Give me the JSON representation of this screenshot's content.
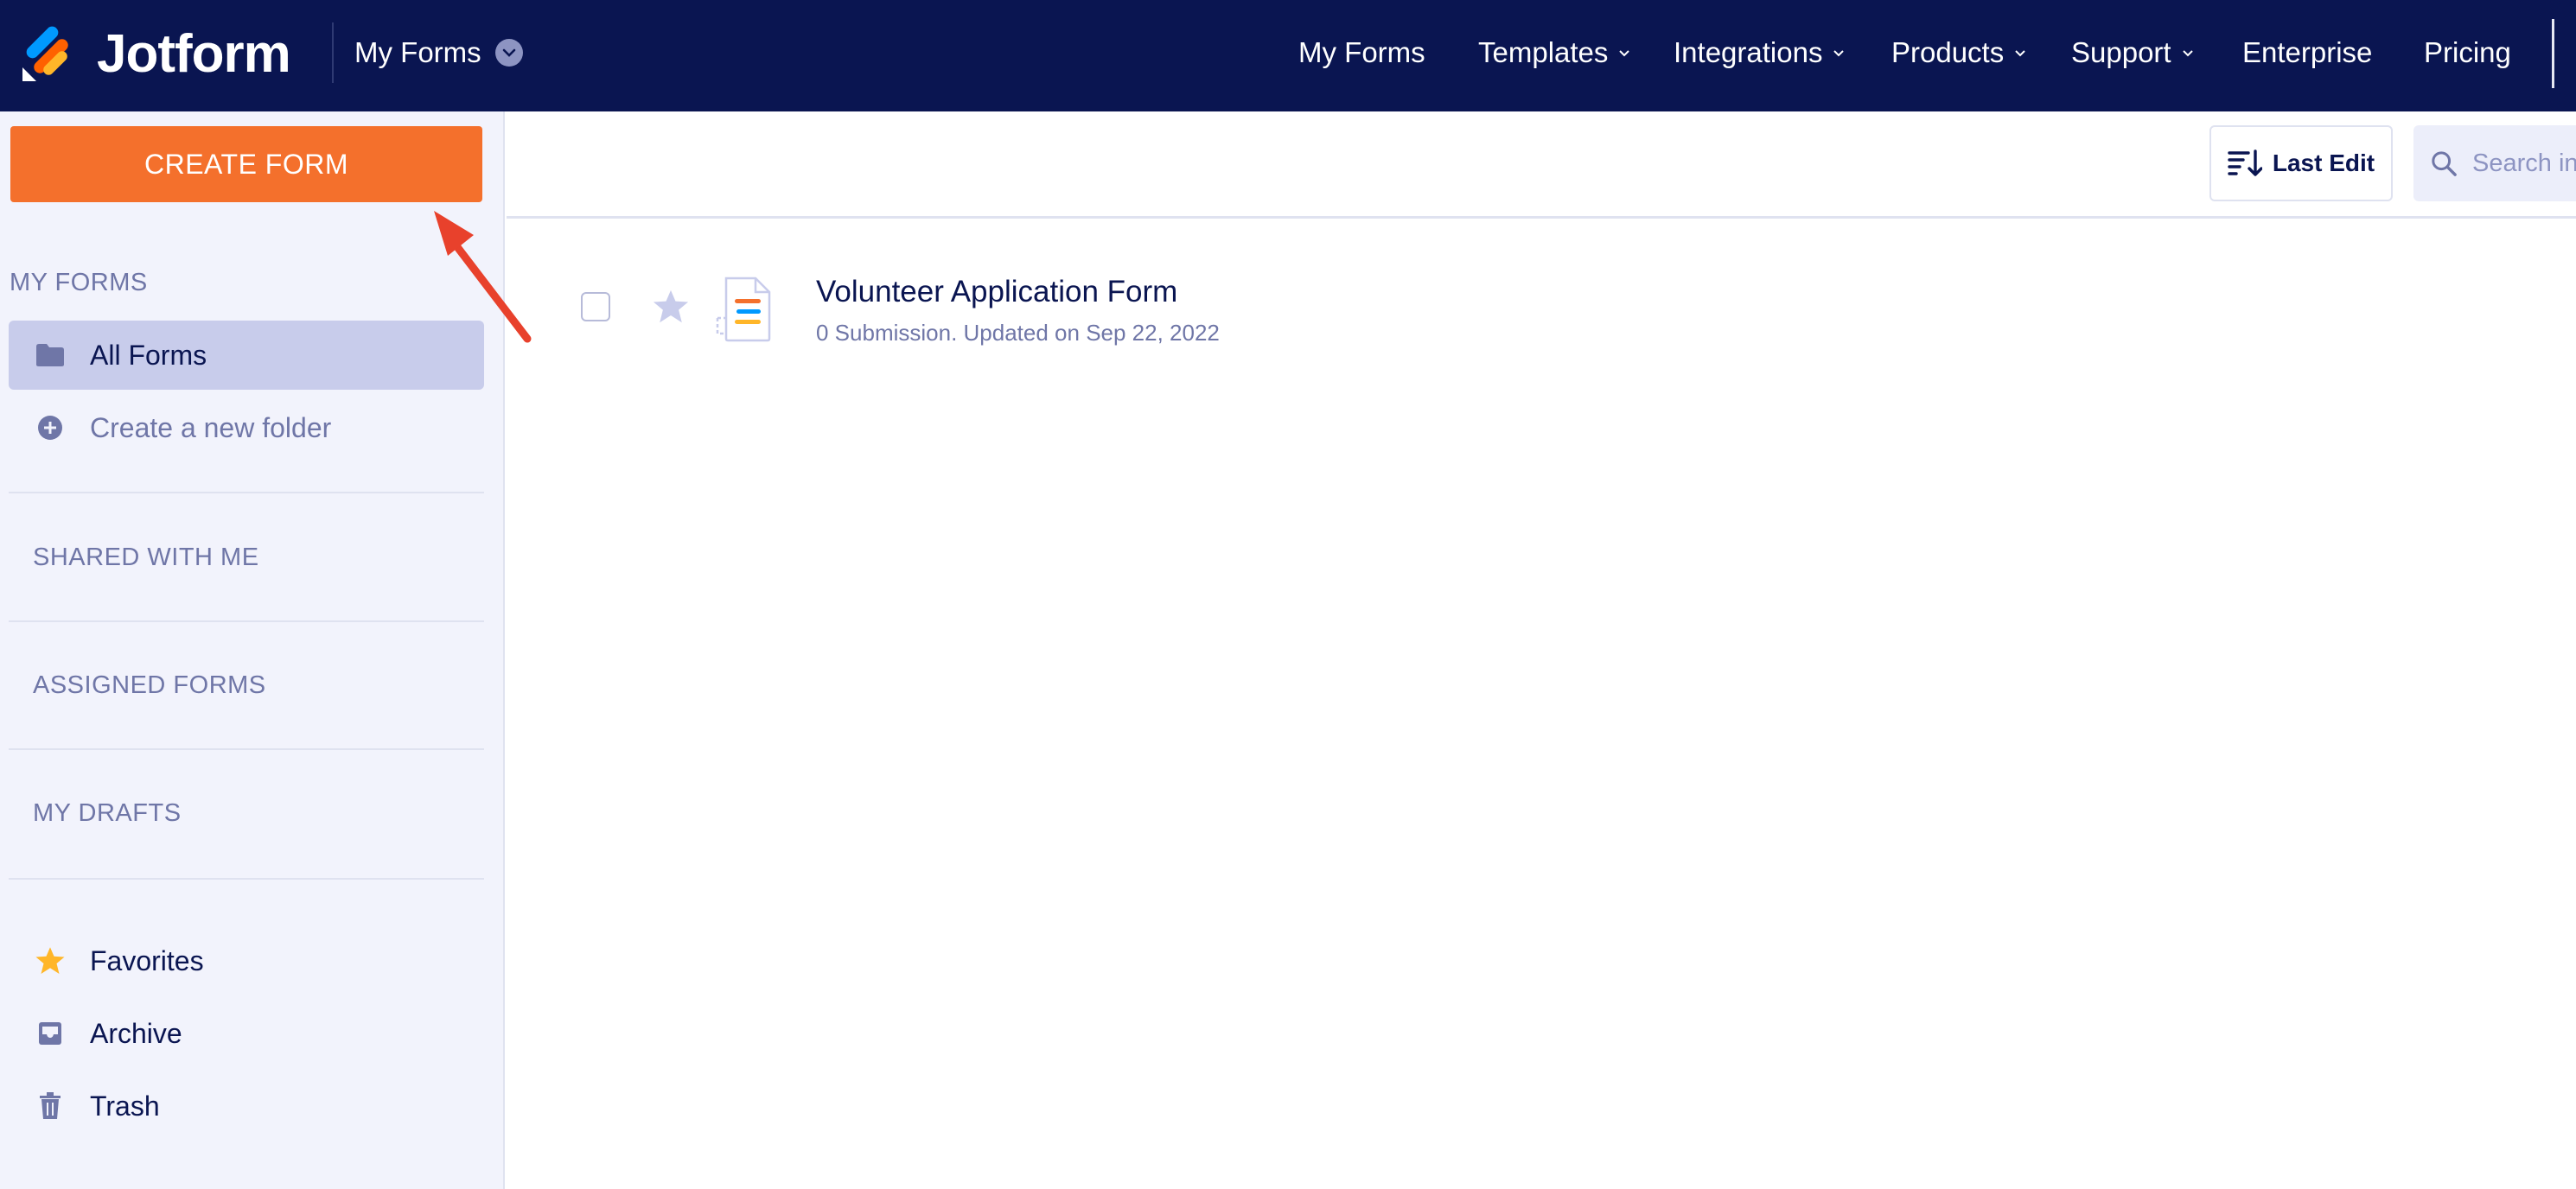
{
  "header": {
    "brand": "Jotform",
    "my_forms_dropdown": "My Forms",
    "nav": [
      {
        "label": "My Forms",
        "has_caret": false
      },
      {
        "label": "Templates",
        "has_caret": true
      },
      {
        "label": "Integrations",
        "has_caret": true
      },
      {
        "label": "Products",
        "has_caret": true
      },
      {
        "label": "Support",
        "has_caret": true
      },
      {
        "label": "Enterprise",
        "has_caret": false
      },
      {
        "label": "Pricing",
        "has_caret": false
      }
    ]
  },
  "sidebar": {
    "create_button": "CREATE FORM",
    "my_forms_label": "MY FORMS",
    "all_forms": "All Forms",
    "create_folder": "Create a new folder",
    "shared_with_me": "SHARED WITH ME",
    "assigned_forms": "ASSIGNED FORMS",
    "my_drafts": "MY DRAFTS",
    "favorites": "Favorites",
    "archive": "Archive",
    "trash": "Trash"
  },
  "toolbar": {
    "sort_label": "Last Edit",
    "search_placeholder": "Search in"
  },
  "forms": [
    {
      "title": "Volunteer Application Form",
      "subtitle": "0 Submission. Updated on Sep 22, 2022"
    }
  ],
  "colors": {
    "header_bg": "#0a1551",
    "accent_orange": "#f4702c",
    "sidebar_bg": "#f2f3fc",
    "active_item_bg": "#c8cceb",
    "annotation_arrow": "#e8412c"
  },
  "icons": {
    "logo": "jotform-logo-icon",
    "dropdown": "chevron-down-icon",
    "folder": "folder-icon",
    "add_folder": "plus-circle-icon",
    "favorites": "star-icon",
    "archive": "archive-tray-icon",
    "trash": "trash-icon",
    "sort": "sort-icon",
    "search": "search-icon",
    "form": "form-document-icon"
  }
}
